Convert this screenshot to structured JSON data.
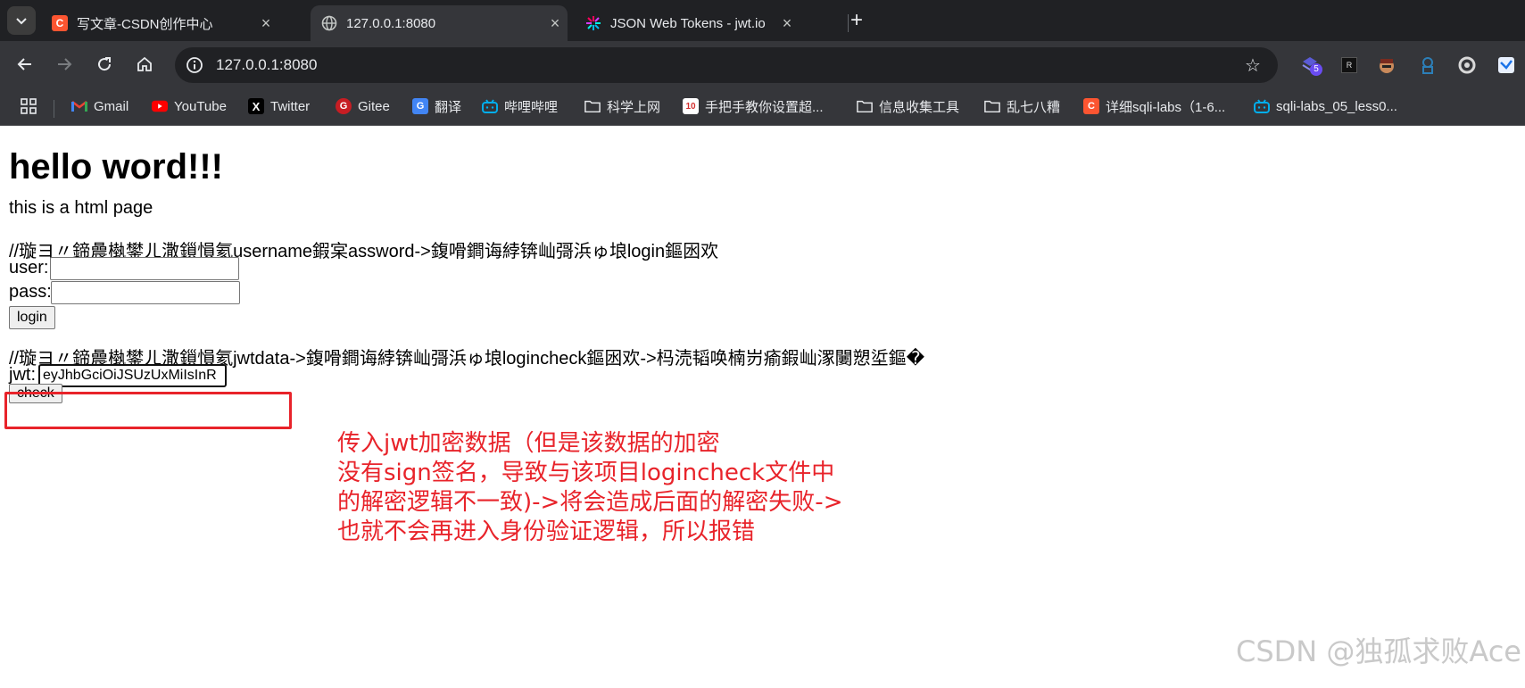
{
  "browser": {
    "tabs": [
      {
        "title": "写文章-CSDN创作中心",
        "icon": "csdn-logo",
        "active": false
      },
      {
        "title": "127.0.0.1:8080",
        "icon": "globe-icon",
        "active": true
      },
      {
        "title": "JSON Web Tokens - jwt.io",
        "icon": "jwt-logo",
        "active": false
      }
    ],
    "tab_close_glyph": "×",
    "new_tab_glyph": "+",
    "address": {
      "url": "127.0.0.1:8080"
    },
    "extensions_badge": "5",
    "bookmarks": [
      {
        "label": "Gmail",
        "icon": "gmail-icon"
      },
      {
        "label": "YouTube",
        "icon": "youtube-icon"
      },
      {
        "label": "Twitter",
        "icon": "x-icon"
      },
      {
        "label": "Gitee",
        "icon": "gitee-icon"
      },
      {
        "label": "翻译",
        "icon": "translate-icon"
      },
      {
        "label": "哔哩哔哩",
        "icon": "bilibili-icon"
      },
      {
        "label": "科学上网",
        "icon": "folder-icon"
      },
      {
        "label": "手把手教你设置超...",
        "icon": "site-icon"
      },
      {
        "label": "信息收集工具",
        "icon": "folder-icon"
      },
      {
        "label": "乱七八糟",
        "icon": "folder-icon"
      },
      {
        "label": "详细sqli-labs（1-6...",
        "icon": "csdn-logo"
      },
      {
        "label": "sqli-labs_05_less0...",
        "icon": "bilibili-icon"
      }
    ]
  },
  "page": {
    "heading": "hello word!!!",
    "intro": "this is a html page",
    "comment1": "//璇ヨ〃鍗曟槸鐢ㄦ潵鎻愪氦username鍜宲assword->鍑嗗鐧诲綍锛屾彁浜ゅ埌login鏂囦欢",
    "user_label": "user:",
    "pass_label": "pass:",
    "login_button": "login",
    "comment2": "//璇ヨ〃鍗曟槸鐢ㄦ潵鎻愪氦jwtdata->鍑嗗鐧诲綍锛屾彁浜ゅ埌logincheck鏂囦欢->杩涜韬唤楠岃瘉鍜屾潈闄愬垽鏂�",
    "jwt_label": "jwt:",
    "jwt_value": "eyJhbGciOiJSUzUxMiIsInR",
    "check_button": "check"
  },
  "annotation": {
    "lines": [
      "传入jwt加密数据（但是该数据的加密",
      "没有sign签名，导致与该项目logincheck文件中",
      "的解密逻辑不一致)->将会造成后面的解密失败->",
      "也就不会再进入身份验证逻辑，所以报错"
    ],
    "color": "#e8232a"
  },
  "watermark": "CSDN @独孤求败Ace"
}
